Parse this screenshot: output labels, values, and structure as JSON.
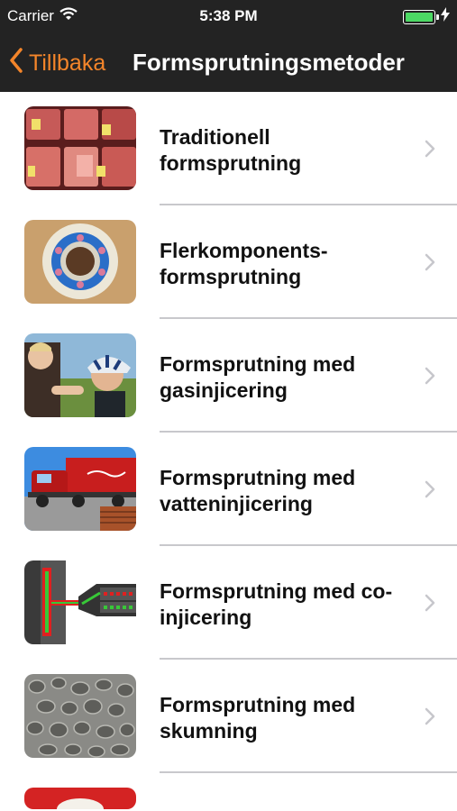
{
  "status_bar": {
    "carrier": "Carrier",
    "time": "5:38 PM"
  },
  "nav": {
    "back_label": "Tillbaka",
    "title": "Formsprutningsmetoder"
  },
  "colors": {
    "accent": "#f4852a",
    "bar_bg": "#232323",
    "battery": "#4cd964"
  },
  "items": [
    {
      "line1": "Traditionell",
      "line2": "formsprutning",
      "icon": "meat-packages-thumbnail"
    },
    {
      "line1": "Flerkomponents-",
      "line2": "formsprutning",
      "icon": "bearing-ring-thumbnail"
    },
    {
      "line1": "Formsprutning med",
      "line2": "gasinjicering",
      "icon": "helmet-fitting-thumbnail"
    },
    {
      "line1": "Formsprutning med",
      "line2": "vatteninjicering",
      "icon": "red-truck-thumbnail"
    },
    {
      "line1": "Formsprutning med co-",
      "line2": "injicering",
      "icon": "coinjection-diagram-thumbnail"
    },
    {
      "line1": "Formsprutning med",
      "line2": "skumning",
      "icon": "foam-structure-thumbnail"
    }
  ]
}
